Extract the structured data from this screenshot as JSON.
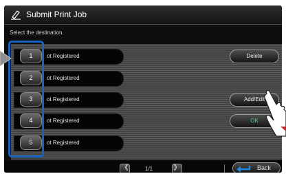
{
  "header": {
    "title": "Submit Print Job",
    "icon": "print-job-icon"
  },
  "prompt": "Select the destination.",
  "destinations": [
    {
      "number": "1",
      "label": "ot Registered"
    },
    {
      "number": "2",
      "label": "ot Registered"
    },
    {
      "number": "3",
      "label": "ot Registered"
    },
    {
      "number": "4",
      "label": "ot Registered"
    },
    {
      "number": "5",
      "label": "ot Registered"
    }
  ],
  "actions": {
    "delete": "Delete",
    "add_edit": "Add/Edit",
    "ok": "OK"
  },
  "pager": {
    "prev": "《",
    "indicator": "1/1",
    "next": "》"
  },
  "back": {
    "label": "Back"
  },
  "colors": {
    "highlight": "#1565c0",
    "ok_text": "#2ee06a",
    "back_arrow": "#1e88e5"
  }
}
